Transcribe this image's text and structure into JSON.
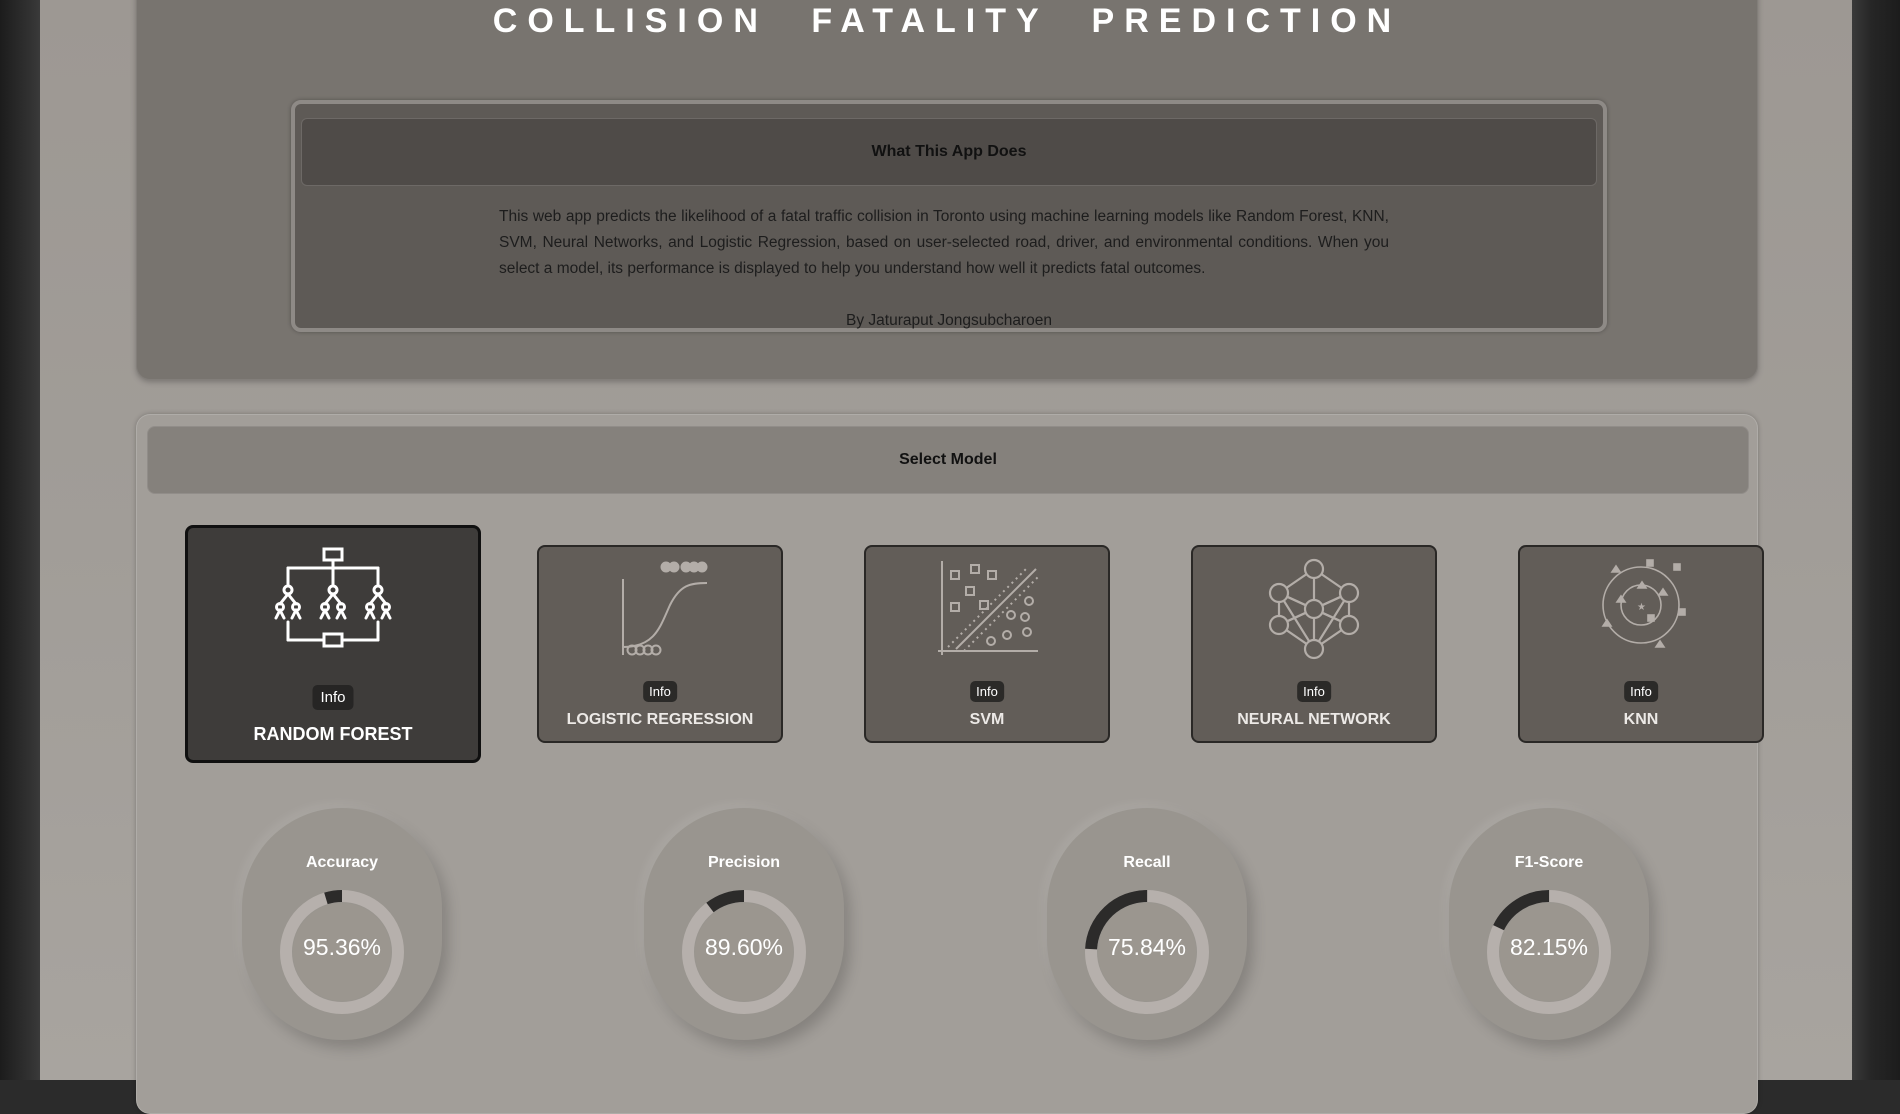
{
  "app": {
    "title": "COLLISION FATALITY PREDICTION",
    "about": {
      "heading": "What This App Does",
      "description": "This web app predicts the likelihood of a fatal traffic collision in Toronto using machine learning models like Random Forest, KNN, SVM, Neural Networks, and Logistic Regression, based on user-selected road, driver, and environmental conditions. When you select a model, its performance is displayed to help you understand how well it predicts fatal outcomes.",
      "author": "By Jaturaput Jongsubcharoen"
    }
  },
  "model_select": {
    "heading": "Select Model",
    "info_label": "Info",
    "models": [
      {
        "name": "RANDOM FOREST",
        "icon": "decision-tree-icon",
        "selected": true
      },
      {
        "name": "LOGISTIC REGRESSION",
        "icon": "sigmoid-curve-icon",
        "selected": false
      },
      {
        "name": "SVM",
        "icon": "svm-hyperplane-icon",
        "selected": false
      },
      {
        "name": "NEURAL NETWORK",
        "icon": "neural-network-icon",
        "selected": false
      },
      {
        "name": "KNN",
        "icon": "knn-clusters-icon",
        "selected": false
      }
    ]
  },
  "metrics": [
    {
      "label": "Accuracy",
      "value_text": "95.36%",
      "value": 95.36
    },
    {
      "label": "Precision",
      "value_text": "89.60%",
      "value": 89.6
    },
    {
      "label": "Recall",
      "value_text": "75.84%",
      "value": 75.84
    },
    {
      "label": "F1-Score",
      "value_text": "82.15%",
      "value": 82.15
    }
  ],
  "colors": {
    "selected_card": "#3e3c3a",
    "card": "#625d58",
    "gauge_track": "#b6b0ac",
    "gauge_remainder": "#2c2b2a"
  }
}
